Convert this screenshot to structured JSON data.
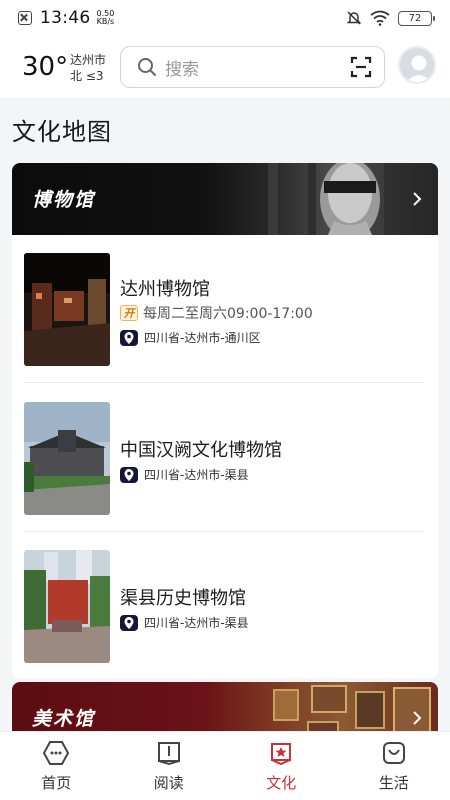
{
  "status_bar": {
    "time": "13:46",
    "speed_value": "0.50",
    "speed_unit": "KB/s",
    "battery": "72"
  },
  "header": {
    "temperature": "30°",
    "city": "达州市",
    "wind": "北 ≤3",
    "search_placeholder": "搜索"
  },
  "page_title": "文化地图",
  "sections": {
    "museum": {
      "title": "博物馆",
      "items": [
        {
          "name": "达州博物馆",
          "badge": "开",
          "hours": "每周二至周六09:00-17:00",
          "location": "四川省-达州市-通川区"
        },
        {
          "name": "中国汉阙文化博物馆",
          "location": "四川省-达州市-渠县"
        },
        {
          "name": "渠县历史博物馆",
          "location": "四川省-达州市-渠县"
        }
      ]
    },
    "art": {
      "title": "美术馆"
    }
  },
  "tabbar": {
    "tabs": [
      {
        "label": "首页",
        "icon": "home-icon"
      },
      {
        "label": "阅读",
        "icon": "book-icon"
      },
      {
        "label": "文化",
        "icon": "culture-icon"
      },
      {
        "label": "生活",
        "icon": "life-icon"
      }
    ],
    "active_index": 2,
    "active_color": "#c8323a"
  }
}
